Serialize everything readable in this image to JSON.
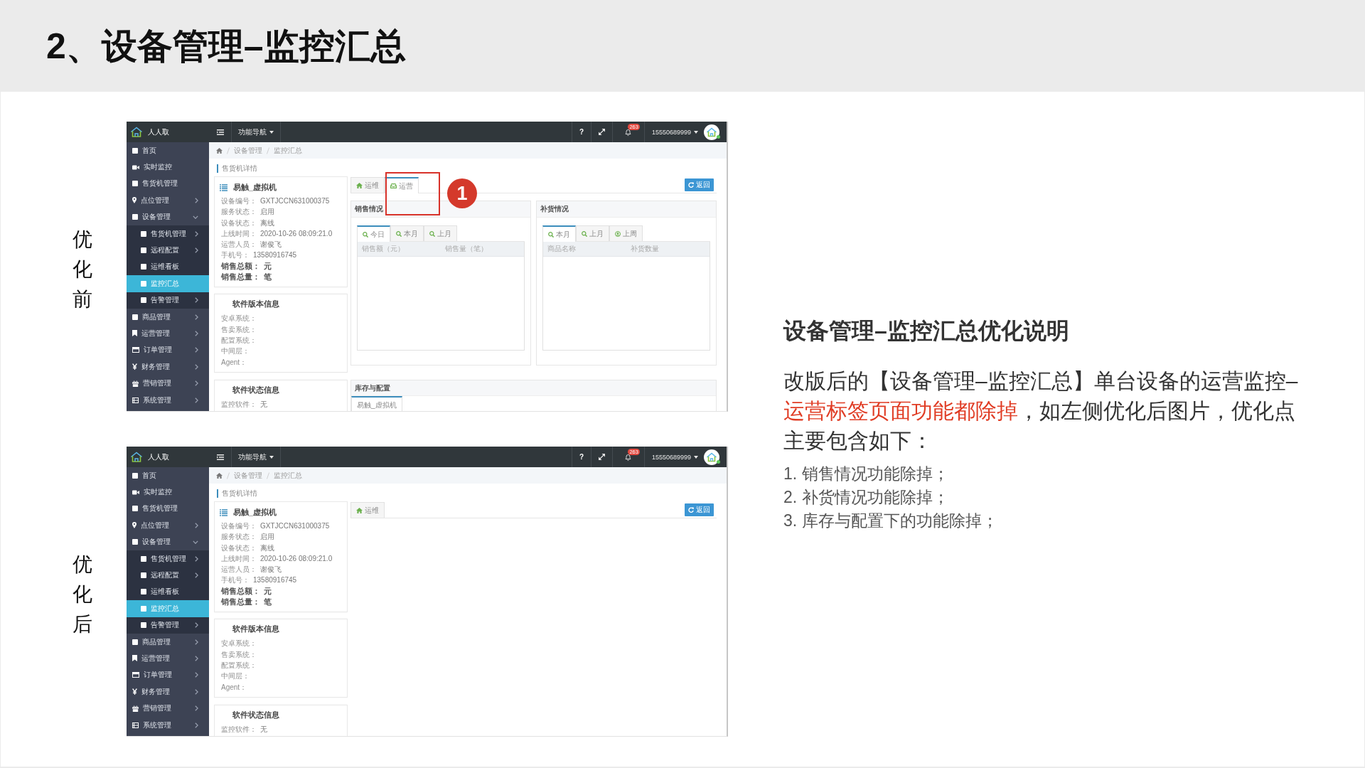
{
  "title": "2、设备管理–监控汇总",
  "sections": [
    {
      "label": "优化前",
      "screen": {
        "brand": "人人取",
        "nav_menu": "功能导航",
        "help": "?",
        "notification_count": "263",
        "user": "15550689999",
        "sidebar": [
          {
            "label": "首页",
            "kind": "link",
            "selected": false
          },
          {
            "label": "实时监控",
            "kind": "link",
            "selected": false
          },
          {
            "label": "售货机管理",
            "kind": "link",
            "selected": false
          },
          {
            "label": "点位管理",
            "kind": "menu",
            "expanded": false,
            "selected": false
          },
          {
            "label": "设备管理",
            "kind": "menu",
            "expanded": true,
            "selected": false,
            "children": [
              {
                "label": "售货机管理",
                "kind": "menu",
                "expanded": false,
                "selected": false
              },
              {
                "label": "远程配置",
                "kind": "menu",
                "expanded": false,
                "selected": false
              },
              {
                "label": "运维看板",
                "kind": "link",
                "selected": false
              },
              {
                "label": "监控汇总",
                "kind": "link",
                "selected": true
              },
              {
                "label": "告警管理",
                "kind": "menu",
                "expanded": false,
                "selected": false
              }
            ]
          },
          {
            "label": "商品管理",
            "kind": "menu",
            "expanded": false,
            "selected": false
          },
          {
            "label": "运营管理",
            "kind": "menu",
            "expanded": false,
            "selected": false
          },
          {
            "label": "订单管理",
            "kind": "menu",
            "expanded": false,
            "selected": false
          },
          {
            "label": "财务管理",
            "kind": "menu",
            "expanded": false,
            "selected": false
          },
          {
            "label": "营销管理",
            "kind": "menu",
            "expanded": false,
            "selected": false
          },
          {
            "label": "系统管理",
            "kind": "menu",
            "expanded": false,
            "selected": false
          }
        ],
        "breadcrumb": [
          "设备管理",
          "监控汇总"
        ],
        "section_title": "售货机详情",
        "device_card": {
          "name": "易触_虚拟机",
          "fields": [
            {
              "label": "设备编号：",
              "value": "GXTJCCN631000375",
              "kind": "info"
            },
            {
              "label": "服务状态：",
              "value": "启用",
              "kind": "info"
            },
            {
              "label": "设备状态：",
              "value": "离线",
              "kind": "info"
            },
            {
              "label": "上线时间：",
              "value": "2020-10-26 08:09:21.0",
              "kind": "info"
            },
            {
              "label": "运营人员：",
              "value": "谢俊飞",
              "kind": "info"
            },
            {
              "label": "手机号：",
              "value": "13580916745",
              "kind": "info"
            },
            {
              "label": "销售总额：",
              "value": "元",
              "kind": "total"
            },
            {
              "label": "销售总量：",
              "value": "笔",
              "kind": "total"
            }
          ]
        },
        "version_card": {
          "title": "软件版本信息",
          "fields": [
            {
              "label": "安卓系统："
            },
            {
              "label": "售卖系统："
            },
            {
              "label": "配置系统："
            },
            {
              "label": "中间层："
            },
            {
              "label": "Agent："
            }
          ]
        },
        "status_card": {
          "title": "软件状态信息",
          "fields": [
            {
              "label": "监控软件：",
              "value": "无"
            }
          ]
        },
        "tabs": [
          {
            "label": "运维",
            "selected": false
          },
          {
            "label": "运营",
            "selected": true
          }
        ],
        "return_button": "返回",
        "panels": [
          {
            "title": "销售情况",
            "tabs": [
              {
                "label": "今日",
                "selected": true
              },
              {
                "label": "本月",
                "selected": false
              },
              {
                "label": "上月",
                "selected": false
              }
            ],
            "columns": [
              "销售额（元）",
              "销售量（笔）"
            ]
          },
          {
            "title": "补货情况",
            "tabs": [
              {
                "label": "本月",
                "selected": true
              },
              {
                "label": "上月",
                "selected": false
              },
              {
                "label": "上周",
                "selected": false
              }
            ],
            "columns": [
              "商品名称",
              "补货数量"
            ]
          }
        ],
        "inventory": {
          "title": "库存与配置",
          "tabs": [
            {
              "label": "易触_虚拟机",
              "selected": true
            }
          ]
        },
        "callout": {
          "number": "1"
        }
      }
    },
    {
      "label": "优化后",
      "screen": {
        "brand": "人人取",
        "nav_menu": "功能导航",
        "help": "?",
        "notification_count": "263",
        "user": "15550689999",
        "sidebar": [
          {
            "label": "首页",
            "kind": "link",
            "selected": false
          },
          {
            "label": "实时监控",
            "kind": "link",
            "selected": false
          },
          {
            "label": "售货机管理",
            "kind": "link",
            "selected": false
          },
          {
            "label": "点位管理",
            "kind": "menu",
            "expanded": false,
            "selected": false
          },
          {
            "label": "设备管理",
            "kind": "menu",
            "expanded": true,
            "selected": false,
            "children": [
              {
                "label": "售货机管理",
                "kind": "menu",
                "expanded": false,
                "selected": false
              },
              {
                "label": "远程配置",
                "kind": "menu",
                "expanded": false,
                "selected": false
              },
              {
                "label": "运维看板",
                "kind": "link",
                "selected": false
              },
              {
                "label": "监控汇总",
                "kind": "link",
                "selected": true
              },
              {
                "label": "告警管理",
                "kind": "menu",
                "expanded": false,
                "selected": false
              }
            ]
          },
          {
            "label": "商品管理",
            "kind": "menu",
            "expanded": false,
            "selected": false
          },
          {
            "label": "运营管理",
            "kind": "menu",
            "expanded": false,
            "selected": false
          },
          {
            "label": "订单管理",
            "kind": "menu",
            "expanded": false,
            "selected": false
          },
          {
            "label": "财务管理",
            "kind": "menu",
            "expanded": false,
            "selected": false
          },
          {
            "label": "营销管理",
            "kind": "menu",
            "expanded": false,
            "selected": false
          },
          {
            "label": "系统管理",
            "kind": "menu",
            "expanded": false,
            "selected": false
          }
        ],
        "breadcrumb": [
          "设备管理",
          "监控汇总"
        ],
        "section_title": "售货机详情",
        "device_card": {
          "name": "易触_虚拟机",
          "fields": [
            {
              "label": "设备编号：",
              "value": "GXTJCCN631000375",
              "kind": "info"
            },
            {
              "label": "服务状态：",
              "value": "启用",
              "kind": "info"
            },
            {
              "label": "设备状态：",
              "value": "离线",
              "kind": "info"
            },
            {
              "label": "上线时间：",
              "value": "2020-10-26 08:09:21.0",
              "kind": "info"
            },
            {
              "label": "运营人员：",
              "value": "谢俊飞",
              "kind": "info"
            },
            {
              "label": "手机号：",
              "value": "13580916745",
              "kind": "info"
            },
            {
              "label": "销售总额：",
              "value": "元",
              "kind": "total"
            },
            {
              "label": "销售总量：",
              "value": "笔",
              "kind": "total"
            }
          ]
        },
        "version_card": {
          "title": "软件版本信息",
          "fields": [
            {
              "label": "安卓系统："
            },
            {
              "label": "售卖系统："
            },
            {
              "label": "配置系统："
            },
            {
              "label": "中间层："
            },
            {
              "label": "Agent："
            }
          ]
        },
        "status_card": {
          "title": "软件状态信息",
          "fields": [
            {
              "label": "监控软件：",
              "value": "无"
            }
          ]
        },
        "tabs": [
          {
            "label": "运维",
            "selected": false
          }
        ],
        "return_button": "返回"
      }
    }
  ],
  "notes": {
    "heading": "设备管理–监控汇总优化说明",
    "description": [
      {
        "text": "改版后的【设备管理–监控汇总】单台设备的运营监控–",
        "emphasis": false
      },
      {
        "text": "运营标签页面功能都除掉",
        "emphasis": true
      },
      {
        "text": "，如左侧优化后图片，优化点主要包含如下：",
        "emphasis": false
      }
    ],
    "items": [
      "1. 销售情况功能除掉；",
      "2. 补货情况功能除掉；",
      "3. 库存与配置下的功能除掉；"
    ]
  }
}
